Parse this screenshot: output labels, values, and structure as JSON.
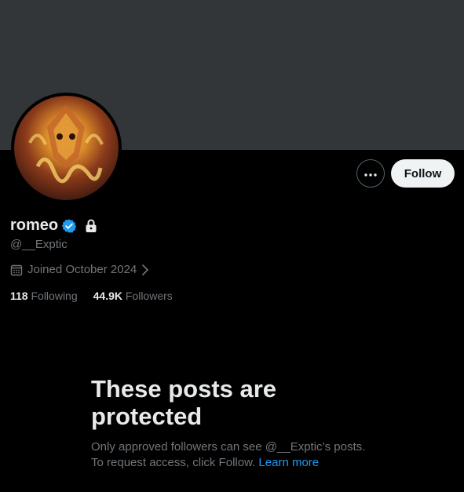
{
  "profile": {
    "display_name": "romeo",
    "handle": "@__Exptic",
    "joined": "Joined October 2024",
    "following_count": "118",
    "following_label": "Following",
    "followers_count": "44.9K",
    "followers_label": "Followers"
  },
  "actions": {
    "follow_label": "Follow"
  },
  "protected": {
    "title_line1": "These posts are",
    "title_line2": "protected",
    "body_line1": "Only approved followers can see @__Exptic’s posts.",
    "body_line2": "To request access, click Follow.",
    "learn_more": "Learn more"
  },
  "icons": {
    "verified": "verified-badge-icon",
    "lock": "lock-icon",
    "calendar": "calendar-icon",
    "more": "more-dots-icon",
    "chevron": "chevron-right-icon"
  },
  "colors": {
    "accent": "#1d9bf0",
    "banner": "#333639",
    "background": "#000000",
    "secondary_text": "#71767b"
  }
}
